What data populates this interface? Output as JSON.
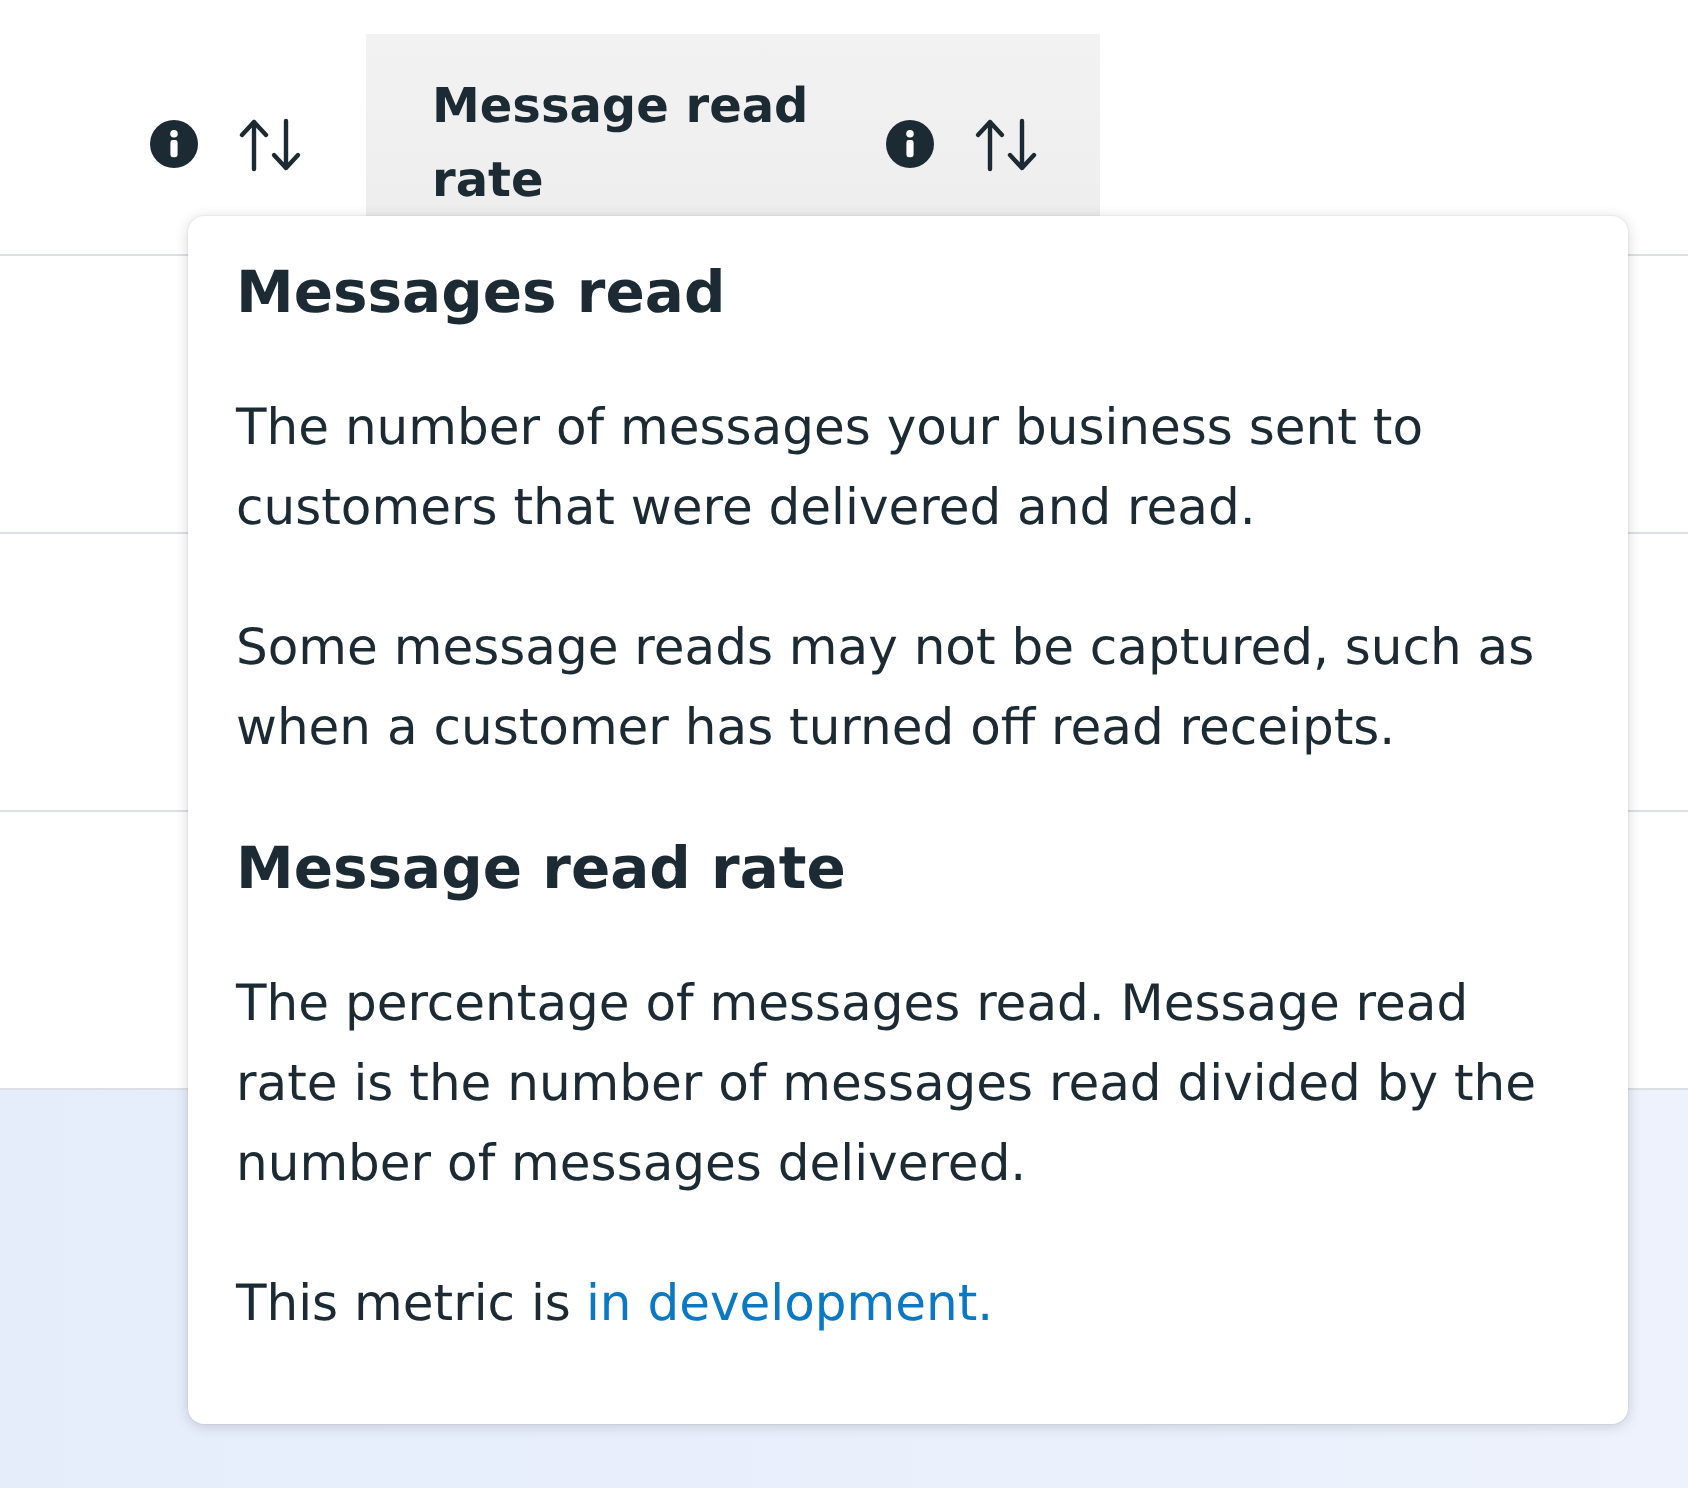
{
  "table": {
    "columns": [
      {
        "selected": false
      },
      {
        "label": "Message read rate",
        "selected": true
      }
    ],
    "rows": [
      {
        "selected": false
      },
      {
        "selected": false
      },
      {
        "selected": false
      },
      {
        "selected": true
      }
    ]
  },
  "tooltip": {
    "sections": [
      {
        "title": "Messages read",
        "paragraphs": [
          {
            "text": "The number of messages your business sent to customers that were delivered and read."
          },
          {
            "text": "Some message reads may not be captured, such as when a customer has turned off read receipts."
          }
        ]
      },
      {
        "title": "Message read rate",
        "paragraphs": [
          {
            "text": "The percentage of messages read. Message read rate is the number of messages read divided by the number of messages delivered."
          },
          {
            "text": "This metric is",
            "link": "in development."
          }
        ]
      }
    ]
  }
}
